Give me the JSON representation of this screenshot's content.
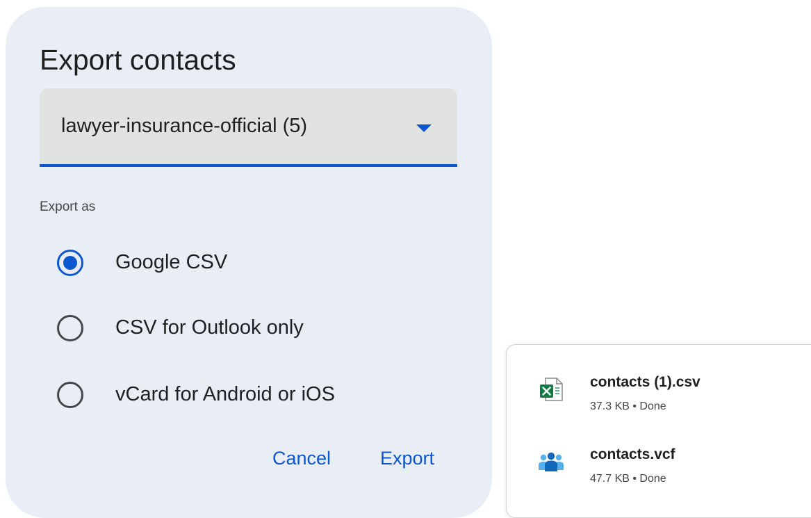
{
  "dialog": {
    "title": "Export contacts",
    "select": {
      "value": "lawyer-insurance-official (5)"
    },
    "export_as_label": "Export as",
    "options": [
      {
        "label": "Google CSV",
        "checked": true
      },
      {
        "label": "CSV for Outlook only",
        "checked": false
      },
      {
        "label": "vCard for Android or iOS",
        "checked": false
      }
    ],
    "buttons": {
      "cancel": "Cancel",
      "export": "Export"
    },
    "colors": {
      "background": "#e9eef6",
      "accent": "#0b57d0",
      "field": "#e1e3e1"
    }
  },
  "downloads": {
    "items": [
      {
        "name": "contacts (1).csv",
        "meta": "37.3 KB • Done",
        "icon": "excel-csv-file-icon"
      },
      {
        "name": "contacts.vcf",
        "meta": "47.7 KB • Done",
        "icon": "contacts-people-icon"
      }
    ]
  }
}
